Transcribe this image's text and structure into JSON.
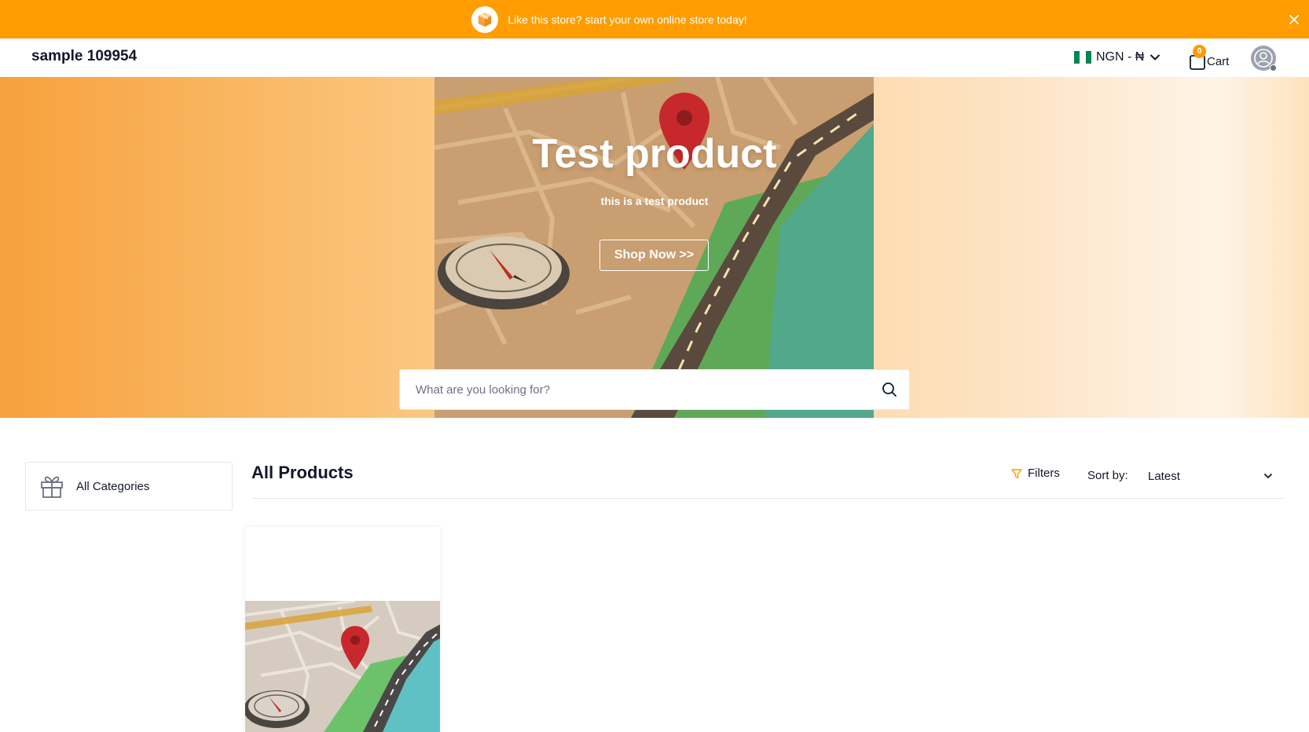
{
  "promo": {
    "text": "Like this store? start your own online store today!",
    "icon": "package-icon",
    "close_icon": "close-icon",
    "color": "#ff9d00"
  },
  "header": {
    "store_name": "sample 109954",
    "currency": "NGN - ₦",
    "cart_label": "Cart",
    "cart_count": "0"
  },
  "hero": {
    "title": "Test product",
    "subtitle": "this is a test product",
    "cta_label": "Shop Now >>"
  },
  "search": {
    "placeholder": "What are you looking for?"
  },
  "sidebar": {
    "categories_label": "All Categories"
  },
  "products": {
    "title": "All Products",
    "filters_label": "Filters",
    "sort_label": "Sort by:",
    "sort_value": "Latest"
  },
  "colors": {
    "accent": "#ff9d00",
    "text": "#111827"
  }
}
